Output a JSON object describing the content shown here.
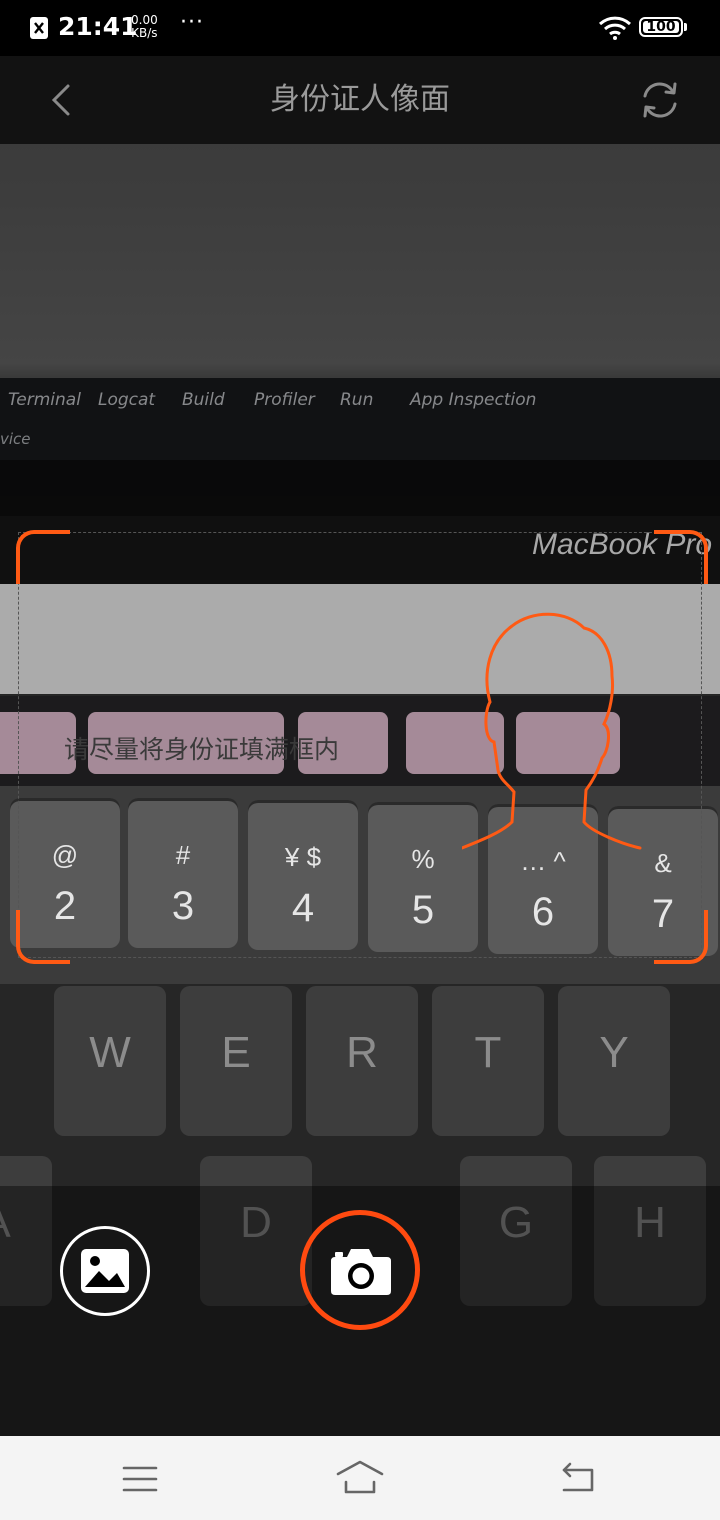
{
  "status_bar": {
    "time": "21:41",
    "net_speed_value": "0.00",
    "net_speed_unit": "KB/s",
    "more": "···",
    "battery": "100"
  },
  "header": {
    "title": "身份证人像面",
    "back_icon": "chevron-left-icon",
    "switch_camera_icon": "refresh-icon"
  },
  "scene": {
    "ide_tabs": [
      "Terminal",
      "Logcat",
      "Build",
      "Profiler",
      "Run",
      "App Inspection"
    ],
    "ide_status": "vice",
    "brand": "MacBook Pro",
    "number_keys": [
      {
        "top": "@",
        "main": "2"
      },
      {
        "top": "#",
        "main": "3"
      },
      {
        "top": "¥  $",
        "main": "4"
      },
      {
        "top": "%",
        "main": "5"
      },
      {
        "top": "…  ^",
        "main": "6"
      },
      {
        "top": "&",
        "main": "7"
      }
    ],
    "letter_keys": [
      "W",
      "E",
      "R",
      "T",
      "Y"
    ],
    "bottom_keys": [
      "A",
      "D",
      "G",
      "H"
    ]
  },
  "frame": {
    "hint": "请尽量将身份证填满框内",
    "accent_color": "#ff5a14"
  },
  "controls": {
    "gallery_icon": "image-icon",
    "shutter_icon": "camera-icon"
  },
  "nav_bar": {
    "menu_icon": "menu-icon",
    "home_icon": "home-icon",
    "back_icon": "back-arrow-icon"
  }
}
